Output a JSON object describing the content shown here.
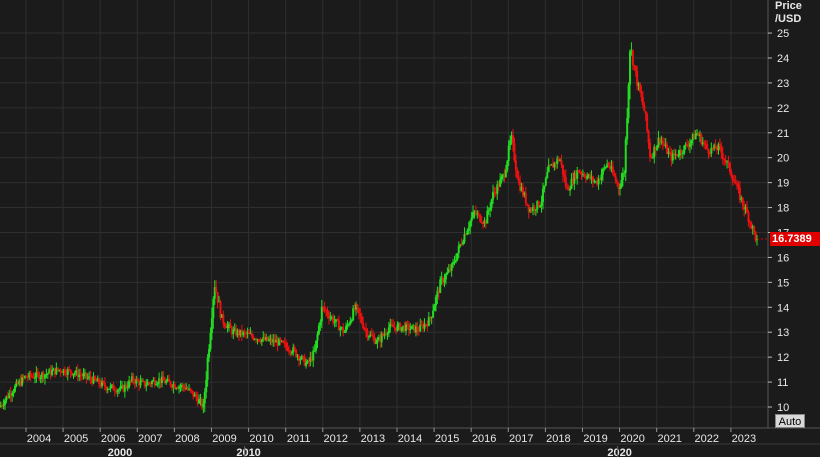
{
  "chart_data": {
    "type": "candlestick",
    "title": "",
    "ylabel": "Price /USD",
    "ylim": [
      9.5,
      26
    ],
    "y_ticks": [
      10,
      11,
      12,
      13,
      14,
      15,
      16,
      17,
      18,
      19,
      20,
      21,
      22,
      23,
      24,
      25
    ],
    "x_ticks_top": [
      "2004",
      "2005",
      "2006",
      "2007",
      "2008",
      "2009",
      "2010",
      "2011",
      "2012",
      "2013",
      "2014",
      "2015",
      "2016",
      "2017",
      "2018",
      "2019",
      "2020",
      "2021",
      "2022",
      "2023"
    ],
    "x_ticks_top_years": [
      2004,
      2005,
      2006,
      2007,
      2008,
      2009,
      2010,
      2011,
      2012,
      2013,
      2014,
      2015,
      2016,
      2017,
      2018,
      2019,
      2020,
      2021,
      2022,
      2023
    ],
    "x_ticks_bottom": [
      "2000",
      "2010",
      "2020"
    ],
    "x_ticks_bottom_years": [
      2000,
      2010,
      2020
    ],
    "x_range_years": [
      2003.3,
      2024.0
    ],
    "grid": true,
    "colors": {
      "up": "#22dd22",
      "down": "#ee1111",
      "grid": "#2f2f2f",
      "background": "#1b1b1b"
    },
    "last_value_label": "16.7389",
    "last_value": 16.7389,
    "series_key_points": [
      [
        2003.3,
        10.0
      ],
      [
        2003.6,
        10.6
      ],
      [
        2004.0,
        11.2
      ],
      [
        2004.5,
        11.3
      ],
      [
        2004.9,
        11.5
      ],
      [
        2005.3,
        11.4
      ],
      [
        2005.8,
        11.1
      ],
      [
        2006.2,
        10.8
      ],
      [
        2006.6,
        10.7
      ],
      [
        2006.9,
        11.1
      ],
      [
        2007.2,
        10.9
      ],
      [
        2007.6,
        11.1
      ],
      [
        2008.0,
        10.9
      ],
      [
        2008.3,
        10.8
      ],
      [
        2008.6,
        10.4
      ],
      [
        2008.8,
        10.0
      ],
      [
        2008.95,
        12.5
      ],
      [
        2009.1,
        15.0
      ],
      [
        2009.3,
        13.5
      ],
      [
        2009.6,
        13.0
      ],
      [
        2010.0,
        12.9
      ],
      [
        2010.4,
        12.7
      ],
      [
        2010.8,
        12.6
      ],
      [
        2011.2,
        12.3
      ],
      [
        2011.6,
        11.7
      ],
      [
        2011.8,
        12.2
      ],
      [
        2012.0,
        14.0
      ],
      [
        2012.3,
        13.5
      ],
      [
        2012.6,
        13.0
      ],
      [
        2012.9,
        14.0
      ],
      [
        2013.2,
        13.0
      ],
      [
        2013.5,
        12.6
      ],
      [
        2013.8,
        13.2
      ],
      [
        2014.2,
        13.2
      ],
      [
        2014.6,
        13.1
      ],
      [
        2014.9,
        13.5
      ],
      [
        2015.2,
        15.0
      ],
      [
        2015.5,
        15.6
      ],
      [
        2015.8,
        16.8
      ],
      [
        2016.1,
        17.8
      ],
      [
        2016.4,
        17.4
      ],
      [
        2016.6,
        18.5
      ],
      [
        2016.9,
        19.3
      ],
      [
        2017.1,
        20.8
      ],
      [
        2017.3,
        19.0
      ],
      [
        2017.6,
        17.9
      ],
      [
        2017.9,
        18.2
      ],
      [
        2018.1,
        19.5
      ],
      [
        2018.4,
        20.0
      ],
      [
        2018.6,
        18.7
      ],
      [
        2018.9,
        19.5
      ],
      [
        2019.1,
        19.3
      ],
      [
        2019.4,
        19.0
      ],
      [
        2019.7,
        19.8
      ],
      [
        2020.0,
        18.8
      ],
      [
        2020.15,
        19.5
      ],
      [
        2020.3,
        24.5
      ],
      [
        2020.5,
        23.0
      ],
      [
        2020.7,
        21.8
      ],
      [
        2020.85,
        20.0
      ],
      [
        2021.1,
        20.8
      ],
      [
        2021.4,
        20.0
      ],
      [
        2021.7,
        20.3
      ],
      [
        2021.9,
        20.6
      ],
      [
        2022.1,
        21.0
      ],
      [
        2022.4,
        20.3
      ],
      [
        2022.7,
        20.4
      ],
      [
        2023.0,
        19.5
      ],
      [
        2023.3,
        18.3
      ],
      [
        2023.5,
        17.6
      ],
      [
        2023.7,
        16.75
      ]
    ]
  },
  "price_axis_header": {
    "line1": "Price",
    "line2": "/USD"
  },
  "auto_button_label": "Auto"
}
